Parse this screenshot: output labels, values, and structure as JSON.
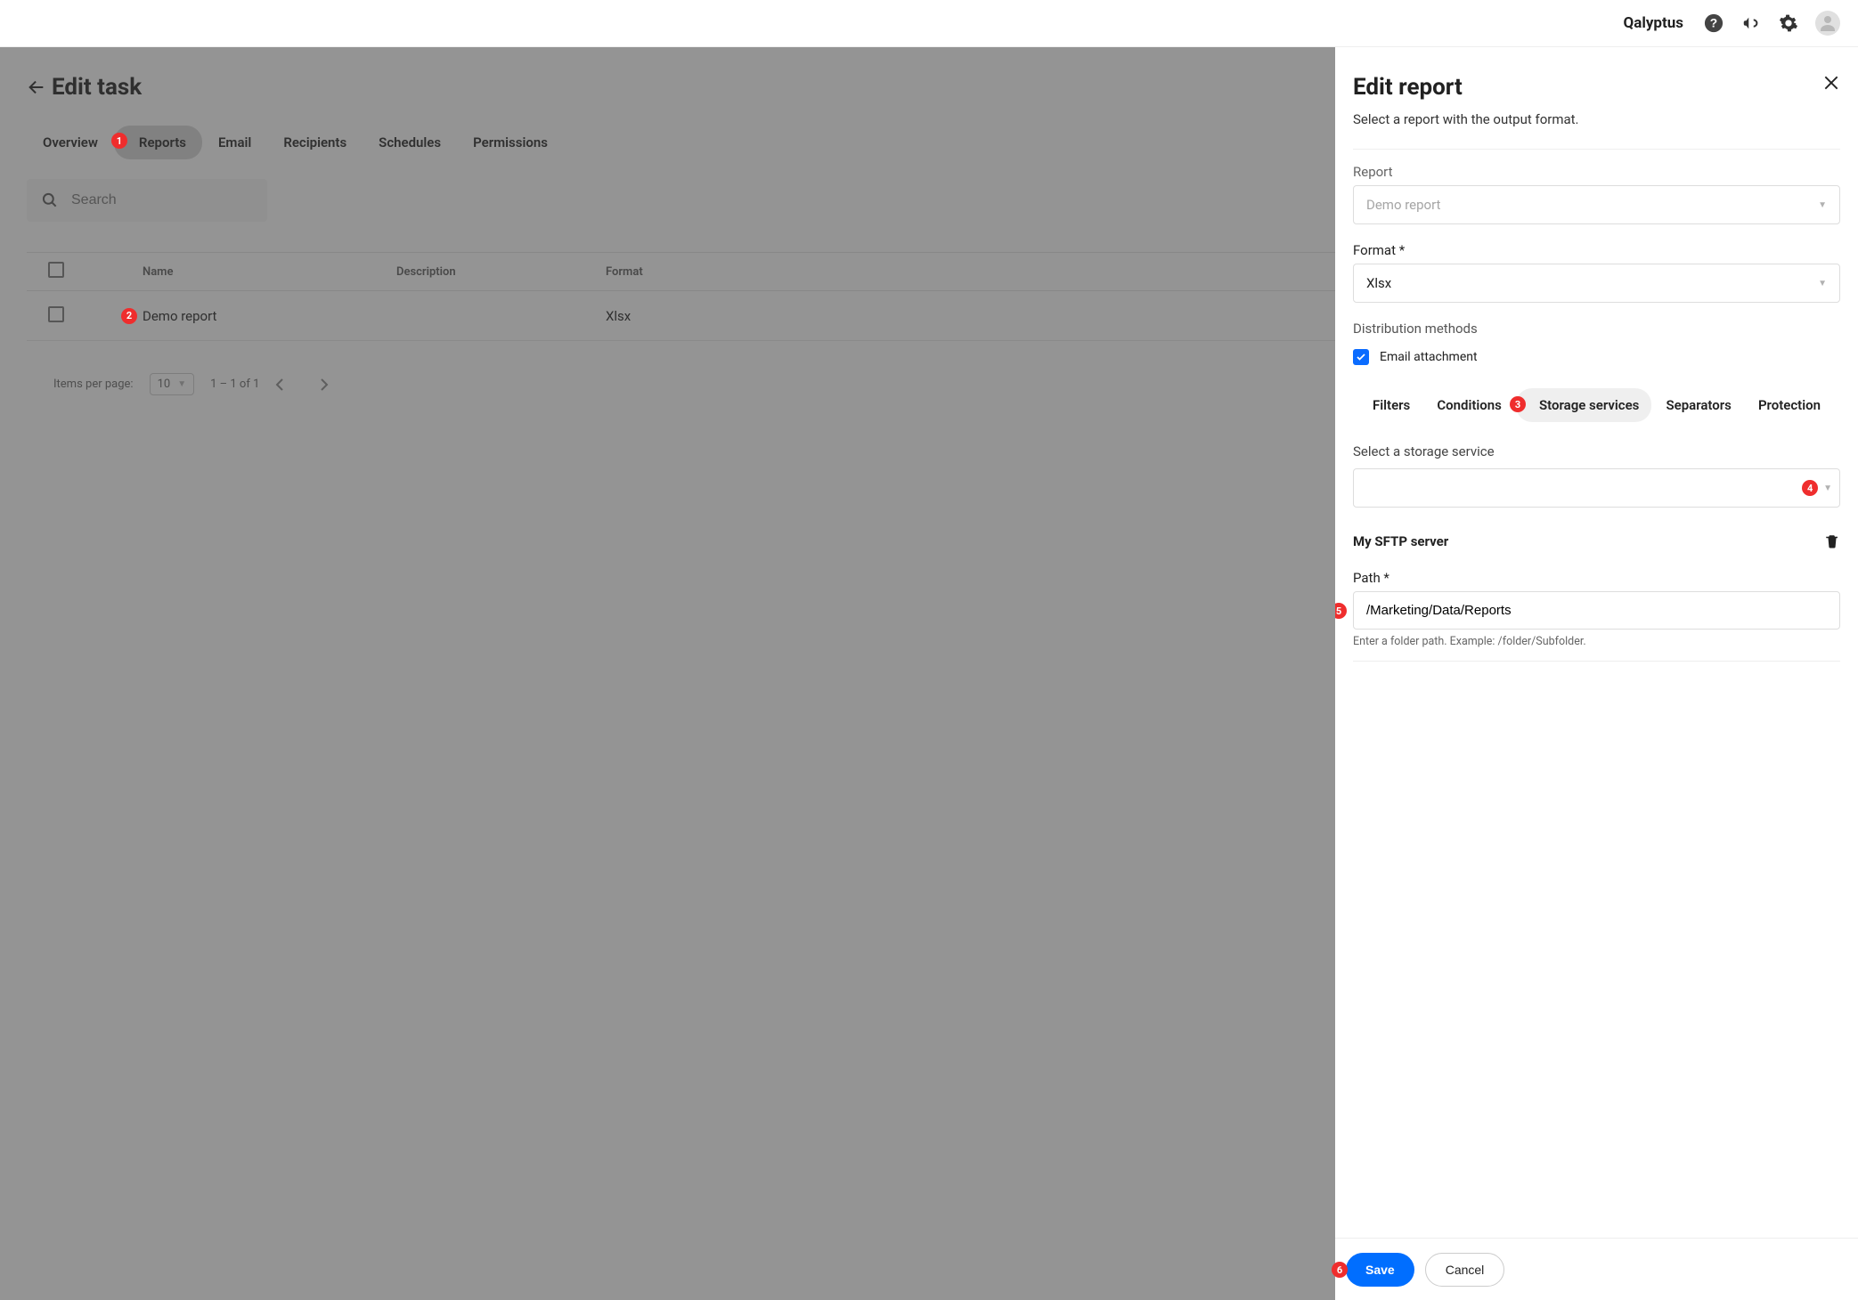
{
  "header": {
    "brand": "Qalyptus"
  },
  "page": {
    "title": "Edit task",
    "tabs": [
      "Overview",
      "Reports",
      "Email",
      "Recipients",
      "Schedules",
      "Permissions"
    ],
    "active_tab_index": 1,
    "search_placeholder": "Search"
  },
  "table": {
    "columns": {
      "name": "Name",
      "description": "Description",
      "format": "Format"
    },
    "rows": [
      {
        "name": "Demo report",
        "description": "",
        "format": "Xlsx"
      }
    ]
  },
  "pagination": {
    "items_per_page_label": "Items per page:",
    "items_per_page": "10",
    "range": "1 – 1 of 1"
  },
  "panel": {
    "title": "Edit report",
    "subtitle": "Select a report with the output format.",
    "report_label": "Report",
    "report_value": "Demo report",
    "format_label": "Format *",
    "format_value": "Xlsx",
    "dist_methods_label": "Distribution methods",
    "email_attachment_label": "Email attachment",
    "subtabs": [
      "Filters",
      "Conditions",
      "Storage services",
      "Separators",
      "Protection"
    ],
    "active_subtab_index": 2,
    "storage_label": "Select a storage service",
    "server_name": "My SFTP server",
    "path_label": "Path *",
    "path_value": "/Marketing/Data/Reports",
    "path_hint": "Enter a folder path. Example: /folder/Subfolder.",
    "save_label": "Save",
    "cancel_label": "Cancel"
  },
  "callouts": {
    "c1": "1",
    "c2": "2",
    "c3": "3",
    "c4": "4",
    "c5": "5",
    "c6": "6"
  }
}
